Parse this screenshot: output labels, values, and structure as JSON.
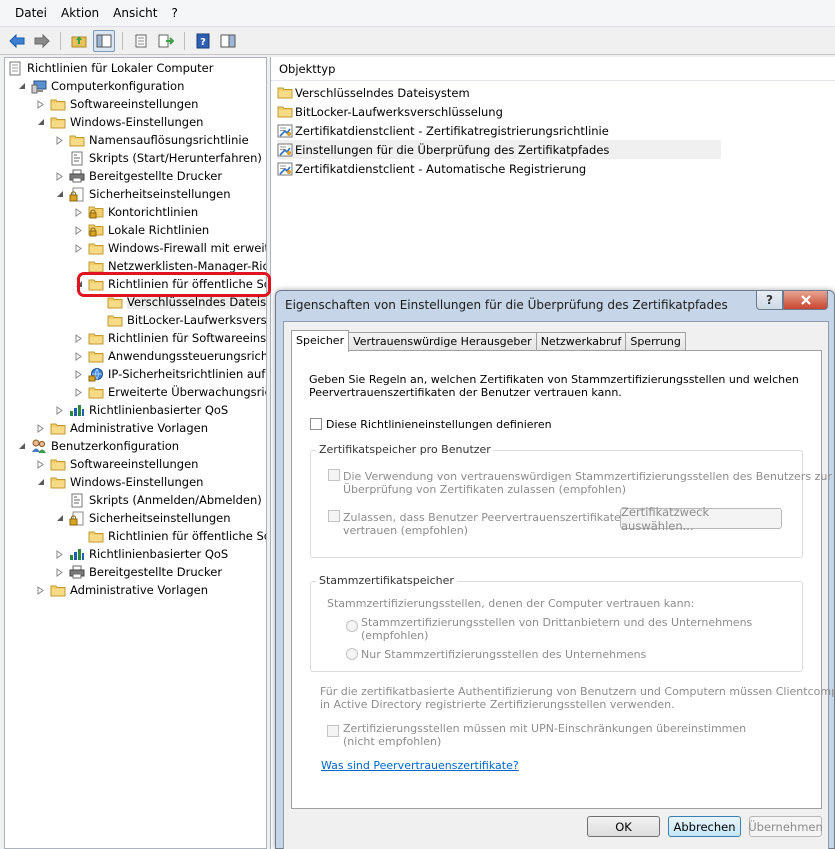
{
  "menu": [
    "Datei",
    "Aktion",
    "Ansicht",
    "?"
  ],
  "tree": [
    {
      "label": "Richtlinien für Lokaler Computer",
      "icon": "policy-doc-icon",
      "level": 0,
      "exp": ""
    },
    {
      "label": "Computerkonfiguration",
      "icon": "computer-icon",
      "level": 1,
      "exp": "open"
    },
    {
      "label": "Softwareeinstellungen",
      "icon": "folder-icon",
      "level": 2,
      "exp": "closed"
    },
    {
      "label": "Windows-Einstellungen",
      "icon": "folder-icon",
      "level": 2,
      "exp": "open"
    },
    {
      "label": "Namensauflösungsrichtlinie",
      "icon": "folder-icon",
      "level": 3,
      "exp": "closed"
    },
    {
      "label": "Skripts (Start/Herunterfahren)",
      "icon": "script-icon",
      "level": 3,
      "exp": ""
    },
    {
      "label": "Bereitgestellte Drucker",
      "icon": "printer-icon",
      "level": 3,
      "exp": "closed"
    },
    {
      "label": "Sicherheitseinstellungen",
      "icon": "security-icon",
      "level": 3,
      "exp": "open"
    },
    {
      "label": "Kontorichtlinien",
      "icon": "lock-folder-icon",
      "level": 4,
      "exp": "closed"
    },
    {
      "label": "Lokale Richtlinien",
      "icon": "lock-folder-icon",
      "level": 4,
      "exp": "closed"
    },
    {
      "label": "Windows-Firewall mit erweiter",
      "icon": "folder-icon",
      "level": 4,
      "exp": "closed"
    },
    {
      "label": "Netzwerklisten-Manager-Richt",
      "icon": "folder-icon",
      "level": 4,
      "exp": ""
    },
    {
      "label": "Richtlinien für öffentliche Schl",
      "icon": "folder-icon",
      "level": 4,
      "exp": "open"
    },
    {
      "label": "Verschlüsselndes Dateisyst",
      "icon": "folder-icon",
      "level": 5,
      "exp": "",
      "highlight": true
    },
    {
      "label": "BitLocker-Laufwerksverschl",
      "icon": "folder-icon",
      "level": 5,
      "exp": ""
    },
    {
      "label": "Richtlinien für Softwareeinschr",
      "icon": "folder-icon",
      "level": 4,
      "exp": "closed"
    },
    {
      "label": "Anwendungssteuerungsrichtli",
      "icon": "folder-icon",
      "level": 4,
      "exp": "closed"
    },
    {
      "label": "IP-Sicherheitsrichtlinien auf Lc",
      "icon": "ipsec-icon",
      "level": 4,
      "exp": "closed"
    },
    {
      "label": "Erweiterte Überwachungsricht",
      "icon": "folder-icon",
      "level": 4,
      "exp": "closed"
    },
    {
      "label": "Richtlinienbasierter QoS",
      "icon": "qos-chart-icon",
      "level": 3,
      "exp": "closed"
    },
    {
      "label": "Administrative Vorlagen",
      "icon": "folder-icon",
      "level": 2,
      "exp": "closed"
    },
    {
      "label": "Benutzerkonfiguration",
      "icon": "users-icon",
      "level": 1,
      "exp": "open"
    },
    {
      "label": "Softwareeinstellungen",
      "icon": "folder-icon",
      "level": 2,
      "exp": "closed"
    },
    {
      "label": "Windows-Einstellungen",
      "icon": "folder-icon",
      "level": 2,
      "exp": "open"
    },
    {
      "label": "Skripts (Anmelden/Abmelden)",
      "icon": "script-icon",
      "level": 3,
      "exp": ""
    },
    {
      "label": "Sicherheitseinstellungen",
      "icon": "security-icon",
      "level": 3,
      "exp": "open"
    },
    {
      "label": "Richtlinien für öffentliche Schl",
      "icon": "folder-icon",
      "level": 4,
      "exp": ""
    },
    {
      "label": "Richtlinienbasierter QoS",
      "icon": "qos-chart-icon",
      "level": 3,
      "exp": "closed"
    },
    {
      "label": "Bereitgestellte Drucker",
      "icon": "printer-icon",
      "level": 3,
      "exp": "closed"
    },
    {
      "label": "Administrative Vorlagen",
      "icon": "folder-icon",
      "level": 2,
      "exp": "closed"
    }
  ],
  "list": {
    "header": "Objekttyp",
    "items": [
      {
        "label": "Verschlüsselndes Dateisystem",
        "icon": "folder-icon"
      },
      {
        "label": "BitLocker-Laufwerksverschlüsselung",
        "icon": "folder-icon"
      },
      {
        "label": "Zertifikatdienstclient - Zertifikatregistrierungsrichtlinie",
        "icon": "certificate-setting-icon"
      },
      {
        "label": "Einstellungen für die Überprüfung des Zertifikatpfades",
        "icon": "certificate-setting-icon",
        "selected": true
      },
      {
        "label": "Zertifikatdienstclient - Automatische Registrierung",
        "icon": "certificate-setting-icon"
      }
    ]
  },
  "dialog": {
    "title": "Eigenschaften von Einstellungen für die Überprüfung des Zertifikatpfades",
    "help": "?",
    "close": "X",
    "tabs": [
      "Speicher",
      "Vertrauenswürdige Herausgeber",
      "Netzwerkabruf",
      "Sperrung"
    ],
    "intro_line1": "Geben Sie Regeln an, welchen Zertifikaten von Stammzertifizierungsstellen und welchen",
    "intro_line2": "Peervertrauenszertifikaten der Benutzer vertrauen kann.",
    "define_checkbox": "Diese Richtlinieneinstellungen definieren",
    "group1_label": "Zertifikatspeicher pro Benutzer",
    "g1_cb1_line1": "Die Verwendung von vertrauenswürdigen Stammzertifizierungsstellen des Benutzers zur",
    "g1_cb1_line2": "Überprüfung von Zertifikaten zulassen (empfohlen)",
    "g1_cb2_line1": "Zulassen, dass Benutzer Peervertrauenszertifikaten",
    "g1_cb2_line2": "vertrauen (empfohlen)",
    "purpose_button": "Zertifikatzweck auswählen...",
    "group2_label": "Stammzertifikatspeicher",
    "g2_desc": "Stammzertifizierungsstellen, denen der Computer vertrauen kann:",
    "g2_radio1_line1": "Stammzertifizierungsstellen von Drittanbietern und des Unternehmens",
    "g2_radio1_line2": "(empfohlen)",
    "g2_radio2": "Nur Stammzertifizierungsstellen des Unternehmens",
    "note_line1": "Für die zertifikatbasierte Authentifizierung von Benutzern und Computern müssen Clientcomputer",
    "note_line2": "in Active Directory registrierte Zertifizierungsstellen verwenden.",
    "upn_line1": "Zertifizierungsstellen müssen mit UPN-Einschränkungen übereinstimmen",
    "upn_line2": "(nicht empfohlen)",
    "link": "Was sind Peervertrauenszertifikate?",
    "ok": "OK",
    "cancel": "Abbrechen",
    "apply": "Übernehmen"
  }
}
